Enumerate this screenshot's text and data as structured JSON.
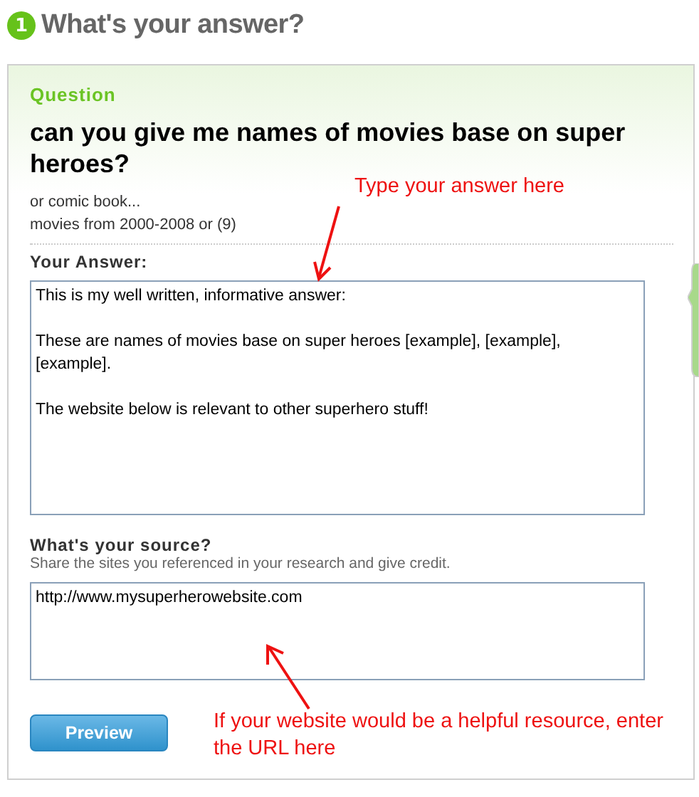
{
  "header": {
    "step": "1",
    "title": "What's your answer?"
  },
  "question": {
    "label": "Question",
    "title": "can you give me names of movies base on super heroes?",
    "details": [
      "or comic book...",
      "movies from 2000-2008 or (9)"
    ]
  },
  "answer": {
    "label": "Your Answer:",
    "value": "This is my well written, informative answer:\n\nThese are names of movies base on super heroes [example], [example], [example].\n\nThe website below is relevant to other superhero stuff!"
  },
  "source": {
    "label": "What's your source?",
    "hint": "Share the sites you referenced in your research and give credit.",
    "value": "http://www.mysuperherowebsite.com"
  },
  "preview_button": "Preview",
  "annotations": [
    {
      "text": "Type your answer here"
    },
    {
      "text": "If your website would be a helpful resource, enter the URL here"
    }
  ]
}
